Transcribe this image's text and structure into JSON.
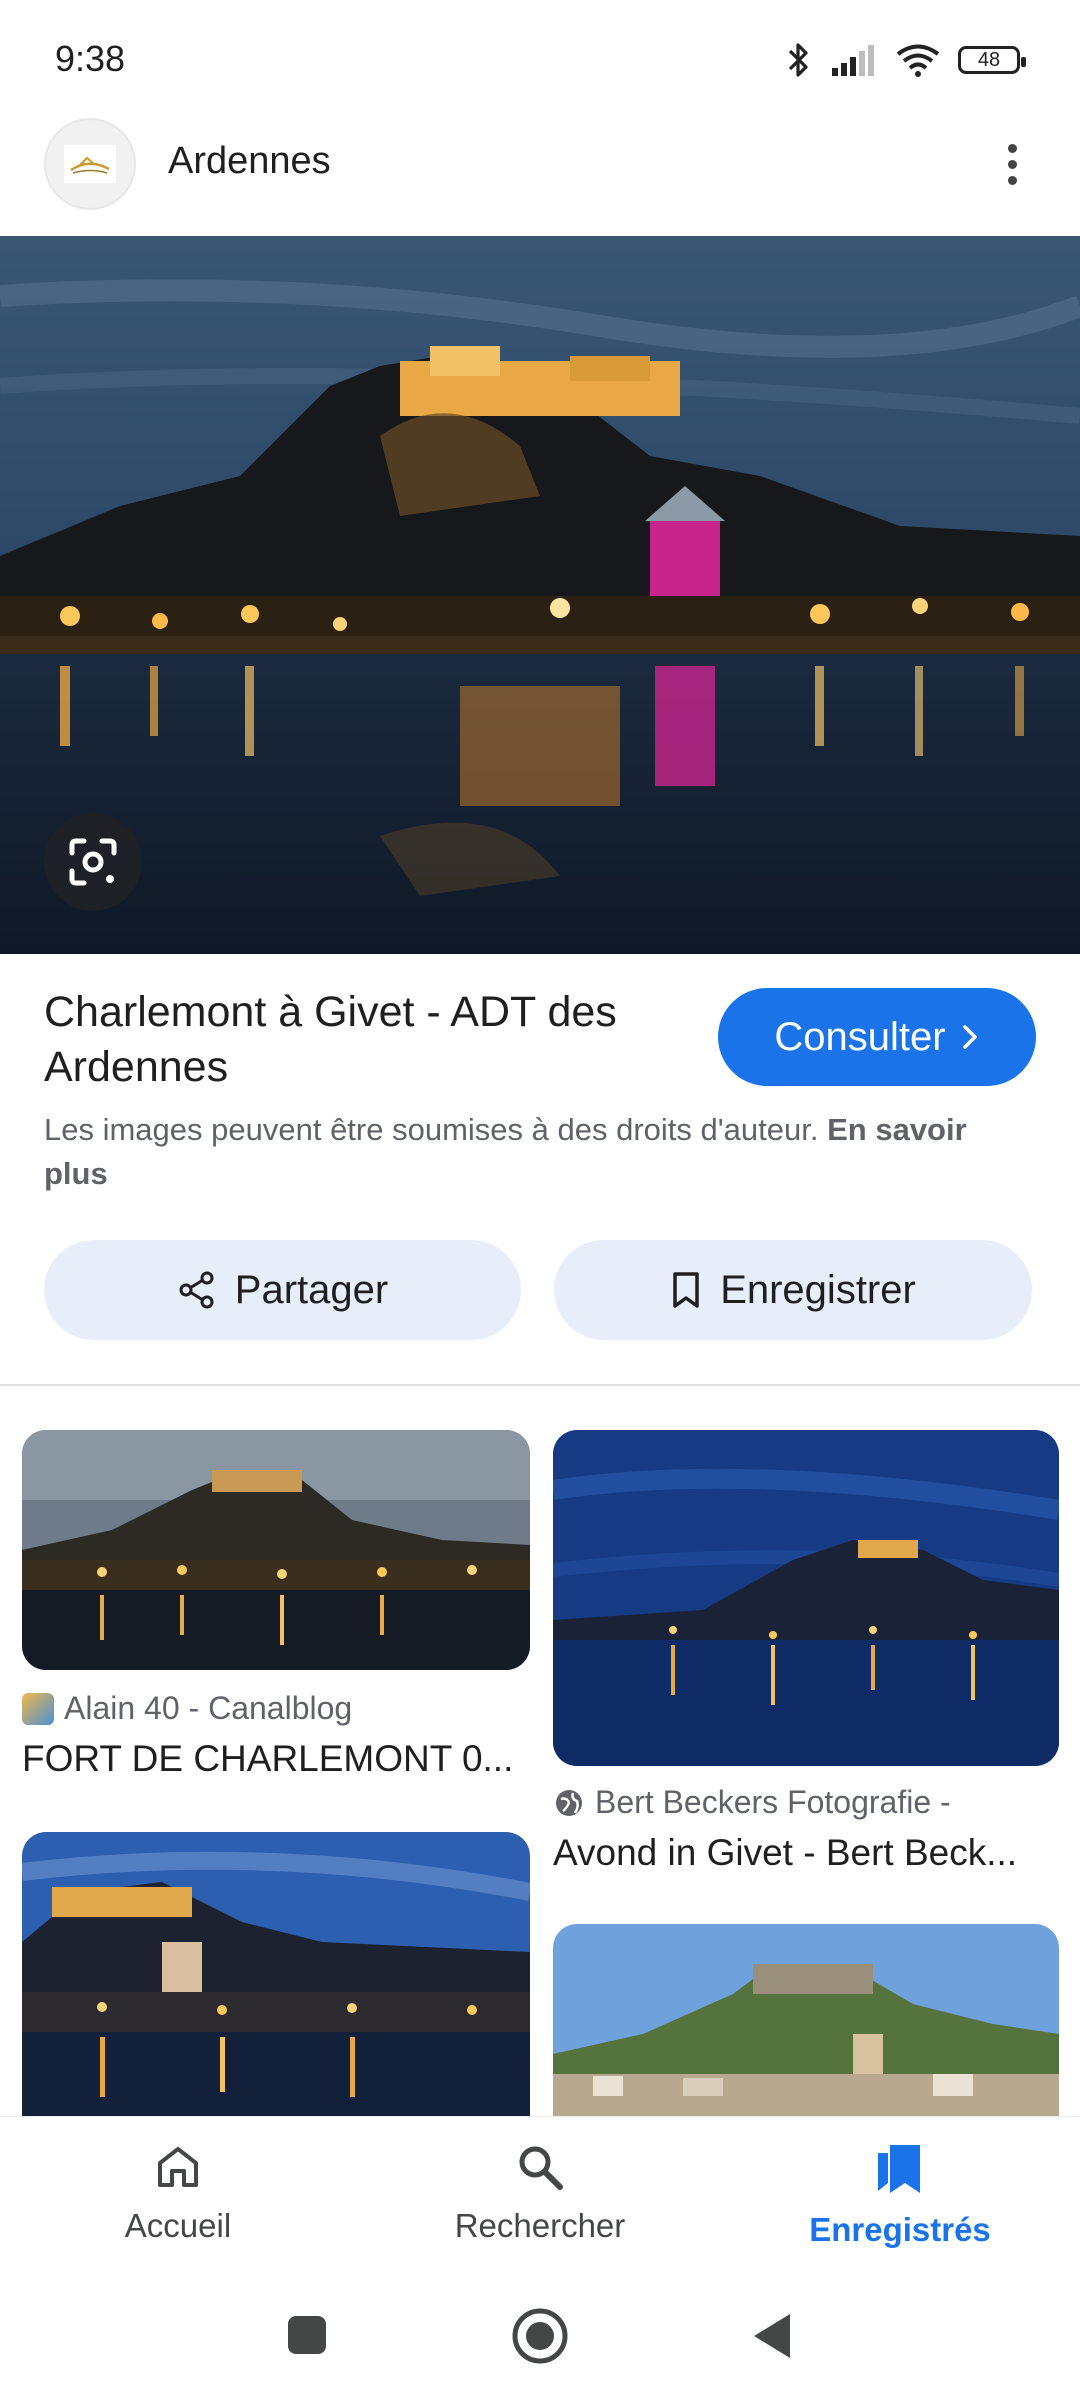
{
  "status_bar": {
    "time": "9:38",
    "battery": "48",
    "icons": [
      "bluetooth-icon",
      "signal-icon",
      "wifi-icon",
      "battery-icon"
    ]
  },
  "header": {
    "title": "Ardennes",
    "more_icon": "more-vert-icon"
  },
  "result": {
    "title": "Charlemont à Givet - ADT des Ardennes",
    "visit_label": "Consulter",
    "copyright_text": "Les images peuvent être soumises à des droits d'auteur.",
    "learn_more_label": "En savoir plus",
    "share_label": "Partager",
    "save_label": "Enregistrer"
  },
  "related": [
    {
      "source": "Alain 40 - Canalblog",
      "title": "FORT DE CHARLEMONT 0..."
    },
    {
      "source": "Bert Beckers Fotografie -",
      "title": "Avond in Givet - Bert Beck..."
    }
  ],
  "bottom_nav": {
    "items": [
      {
        "label": "Accueil",
        "icon": "home-icon",
        "active": false
      },
      {
        "label": "Rechercher",
        "icon": "search-icon",
        "active": false
      },
      {
        "label": "Enregistrés",
        "icon": "bookmarks-icon",
        "active": true
      }
    ]
  },
  "colors": {
    "accent": "#1a73e8",
    "chip_bg": "#e8eef9",
    "muted_text": "#5f6368"
  }
}
